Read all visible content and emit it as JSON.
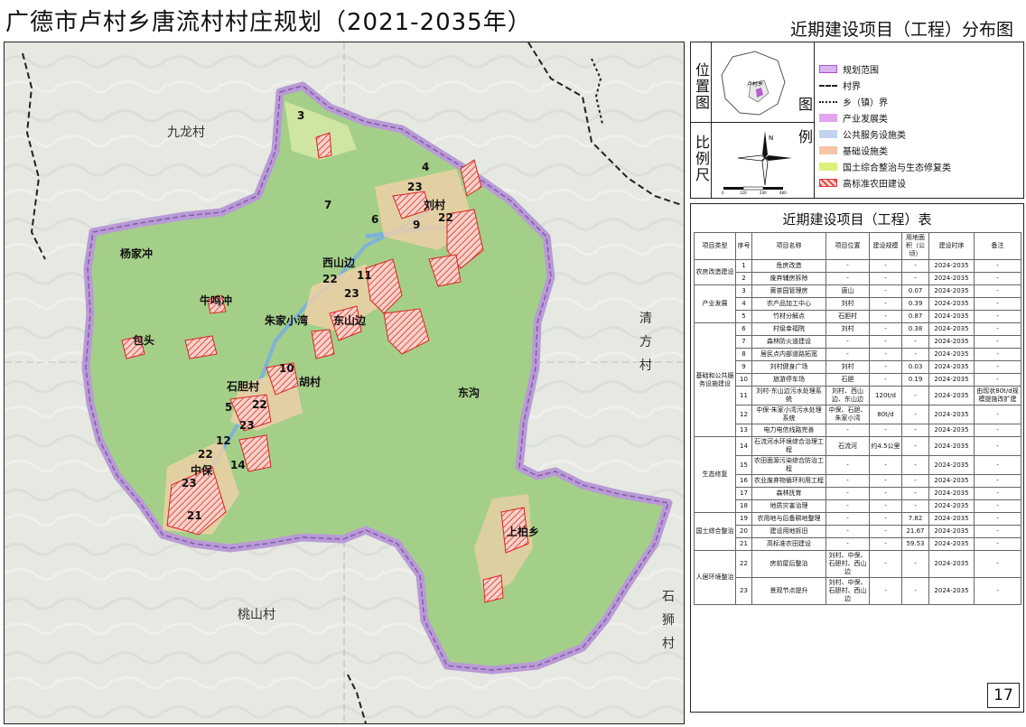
{
  "title": "广德市卢村乡唐流村村庄规划（2021-2035年）",
  "subtitle": "近期建设项目（工程）分布图",
  "page_number": "17",
  "map": {
    "neighbor_villages": [
      {
        "name": "九龙村"
      },
      {
        "name": "清方村"
      },
      {
        "name": "石狮村"
      },
      {
        "name": "桃山村"
      }
    ],
    "places": [
      "杨家冲",
      "牛鸣冲",
      "包头",
      "朱家小湾",
      "西山边",
      "东山边",
      "刘村",
      "石胆村",
      "胡村",
      "东沟",
      "中保",
      "上柏乡"
    ],
    "project_markers": [
      "3",
      "4",
      "7",
      "6",
      "9",
      "23",
      "22",
      "22",
      "11",
      "23",
      "10",
      "5",
      "22",
      "23",
      "12",
      "22",
      "14",
      "23",
      "21"
    ]
  },
  "locator": {
    "label": "位置图",
    "place": "卢村乡"
  },
  "scale": {
    "label": "比例尺",
    "ticks": [
      "0",
      "120",
      "240",
      "480"
    ]
  },
  "legend": {
    "label": "图例",
    "items": [
      {
        "label": "规划范围",
        "color": "#c9a7e6",
        "kind": "boundary"
      },
      {
        "label": "村界",
        "color": "#222",
        "kind": "dash"
      },
      {
        "label": "乡（镇）界",
        "color": "#222",
        "kind": "dashdot"
      },
      {
        "label": "产业发展类",
        "color": "#e3a6ef",
        "kind": "fill"
      },
      {
        "label": "公共服务设施类",
        "color": "#c2d3f2",
        "kind": "fill"
      },
      {
        "label": "基础设施类",
        "color": "#f7c4a6",
        "kind": "fill"
      },
      {
        "label": "国土综合整治与生态修复类",
        "color": "#d9f27a",
        "kind": "fill"
      },
      {
        "label": "高标准农田建设",
        "color": "#e23b3b",
        "kind": "hatch"
      }
    ]
  },
  "table": {
    "title": "近期建设项目（工程）表",
    "headers": [
      "项目类型",
      "序号",
      "项目名称",
      "项目位置",
      "建设规模",
      "用地面积（公顷）",
      "建设时序",
      "备注"
    ],
    "groups": [
      {
        "type": "农房改造建设",
        "rows": [
          [
            "1",
            "危房改造",
            "-",
            "-",
            "-",
            "2024-2035",
            "-"
          ],
          [
            "2",
            "废弃辅房拆除",
            "-",
            "-",
            "-",
            "2024-2035",
            "-"
          ]
        ]
      },
      {
        "type": "产业发展",
        "rows": [
          [
            "3",
            "黄茶园管理房",
            "唐山",
            "-",
            "0.07",
            "2024-2035",
            "-"
          ],
          [
            "4",
            "农产品加工中心",
            "刘村",
            "-",
            "0.39",
            "2024-2035",
            "-"
          ],
          [
            "5",
            "竹材分解点",
            "石胆村",
            "-",
            "0.87",
            "2024-2035",
            "-"
          ]
        ]
      },
      {
        "type": "基础和公共服务设施建设",
        "rows": [
          [
            "6",
            "村级幸福院",
            "刘村",
            "-",
            "0.38",
            "2024-2035",
            "-"
          ],
          [
            "7",
            "森林防火道建设",
            "-",
            "-",
            "-",
            "2024-2035",
            "-"
          ],
          [
            "8",
            "居民点内部道路拓宽",
            "-",
            "-",
            "-",
            "2024-2035",
            "-"
          ],
          [
            "9",
            "刘村健身广场",
            "刘村",
            "-",
            "0.03",
            "2024-2035",
            "-"
          ],
          [
            "10",
            "旅游停车场",
            "石胆",
            "-",
            "0.19",
            "2024-2035",
            "-"
          ],
          [
            "11",
            "刘村-东山边污水处理系统",
            "刘村、西山边、东山边",
            "120t/d",
            "-",
            "2024-2035",
            "由现状80t/d规模提施改扩建"
          ],
          [
            "12",
            "中保-朱家小湾污水处理系统",
            "中保、石胆、朱家小湾",
            "80t/d",
            "-",
            "2024-2035",
            "-"
          ],
          [
            "13",
            "电力电信线路完善",
            "-",
            "-",
            "-",
            "2024-2035",
            "-"
          ]
        ]
      },
      {
        "type": "生态修复",
        "rows": [
          [
            "14",
            "石流河水环境综合治理工程",
            "石流河",
            "约4.5公里",
            "-",
            "2024-2035",
            "-"
          ],
          [
            "15",
            "农田面源污染综合防治工程",
            "-",
            "-",
            "-",
            "2024-2035",
            "-"
          ],
          [
            "16",
            "农业废弃物循环利用工程",
            "-",
            "-",
            "-",
            "2024-2035",
            "-"
          ],
          [
            "17",
            "森林抚育",
            "-",
            "-",
            "-",
            "2024-2035",
            "-"
          ],
          [
            "18",
            "地质灾害治理",
            "-",
            "-",
            "-",
            "2024-2035",
            "-"
          ]
        ]
      },
      {
        "type": "国土综合整治",
        "rows": [
          [
            "19",
            "农用地与后备耕地整理",
            "-",
            "-",
            "7.82",
            "2024-2035",
            "-"
          ],
          [
            "20",
            "建设用地拆旧",
            "-",
            "-",
            "21.67",
            "2024-2035",
            "-"
          ],
          [
            "21",
            "高标准农田建设",
            "-",
            "-",
            "59.53",
            "2024-2035",
            "-"
          ]
        ]
      },
      {
        "type": "人居环境整治",
        "rows": [
          [
            "22",
            "房前屋后整治",
            "刘村、中保、石胆村、西山边",
            "-",
            "-",
            "2024-2035",
            "-"
          ],
          [
            "23",
            "景观节点提升",
            "刘村、中保、石胆村、西山边",
            "-",
            "-",
            "2024-2035",
            "-"
          ]
        ]
      }
    ]
  }
}
